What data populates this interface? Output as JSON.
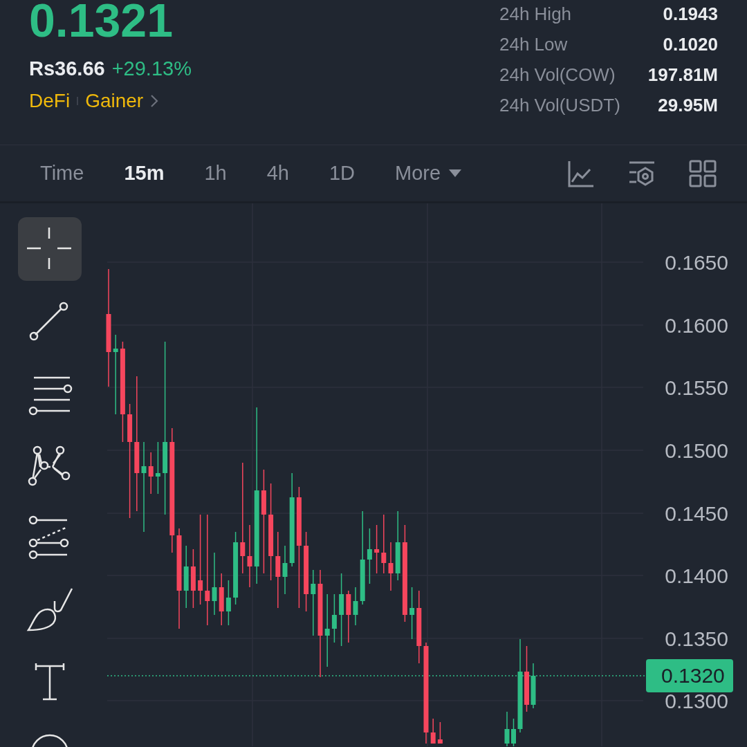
{
  "ticker": {
    "price": "0.1321",
    "fiat_price": "Rs36.66",
    "change": "+29.13%",
    "tags": [
      "DeFi",
      "Gainer"
    ]
  },
  "stats": [
    {
      "label": "24h High",
      "value": "0.1943"
    },
    {
      "label": "24h Low",
      "value": "0.1020"
    },
    {
      "label": "24h Vol(COW)",
      "value": "197.81M"
    },
    {
      "label": "24h Vol(USDT)",
      "value": "29.95M"
    }
  ],
  "intervals": [
    {
      "label": "Time",
      "selected": false
    },
    {
      "label": "15m",
      "selected": true
    },
    {
      "label": "1h",
      "selected": false
    },
    {
      "label": "4h",
      "selected": false
    },
    {
      "label": "1D",
      "selected": false
    },
    {
      "label": "More",
      "selected": false,
      "kind": "dropdown"
    }
  ],
  "tools": [
    {
      "kind": "crosshair",
      "selected": true
    },
    {
      "kind": "trend-line",
      "selected": false
    },
    {
      "kind": "parallel-lines",
      "selected": false
    },
    {
      "kind": "pattern",
      "selected": false
    },
    {
      "kind": "fib",
      "selected": false
    },
    {
      "kind": "brush",
      "selected": false
    },
    {
      "kind": "text",
      "selected": false
    },
    {
      "kind": "shape",
      "selected": false
    }
  ],
  "price_axis": [
    "0.1650",
    "0.1600",
    "0.1550",
    "0.1500",
    "0.1450",
    "0.1400",
    "0.1350",
    "0.1300"
  ],
  "last_price": "0.1320"
}
